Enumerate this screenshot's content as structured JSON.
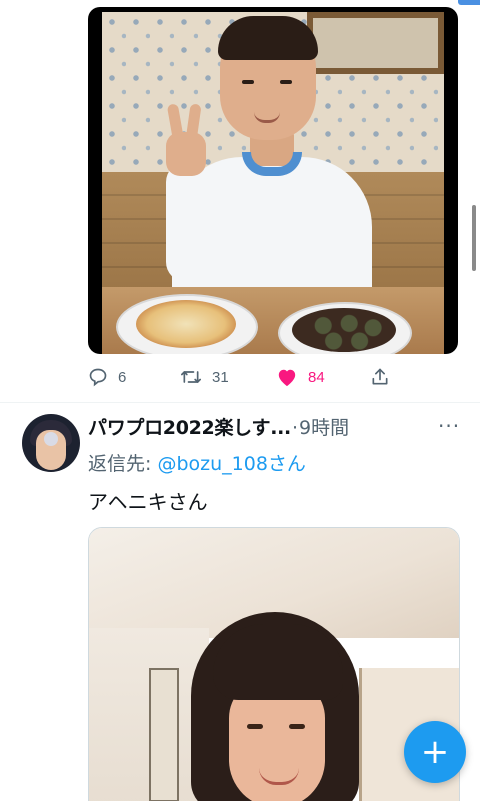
{
  "tweet1": {
    "media_alt": "",
    "actions": {
      "reply": {
        "icon": "reply-icon",
        "count": "6"
      },
      "retweet": {
        "icon": "retweet-icon",
        "count": "31"
      },
      "like": {
        "icon": "heart-filled-icon",
        "count": "84",
        "color": "#f91880"
      },
      "share": {
        "icon": "share-icon"
      }
    }
  },
  "tweet2": {
    "display_name": "パワプロ2022楽しす...",
    "separator": "·",
    "time": "9時間",
    "more": "···",
    "reply_label": "返信先: ",
    "reply_user": "@bozu_108さん",
    "text": "アヘニキさん"
  },
  "fab": {
    "icon": "plus-icon",
    "label": "+",
    "color": "#1d9bf0"
  },
  "colors": {
    "accent": "#1d9bf0",
    "muted": "#536471",
    "like": "#f91880"
  }
}
